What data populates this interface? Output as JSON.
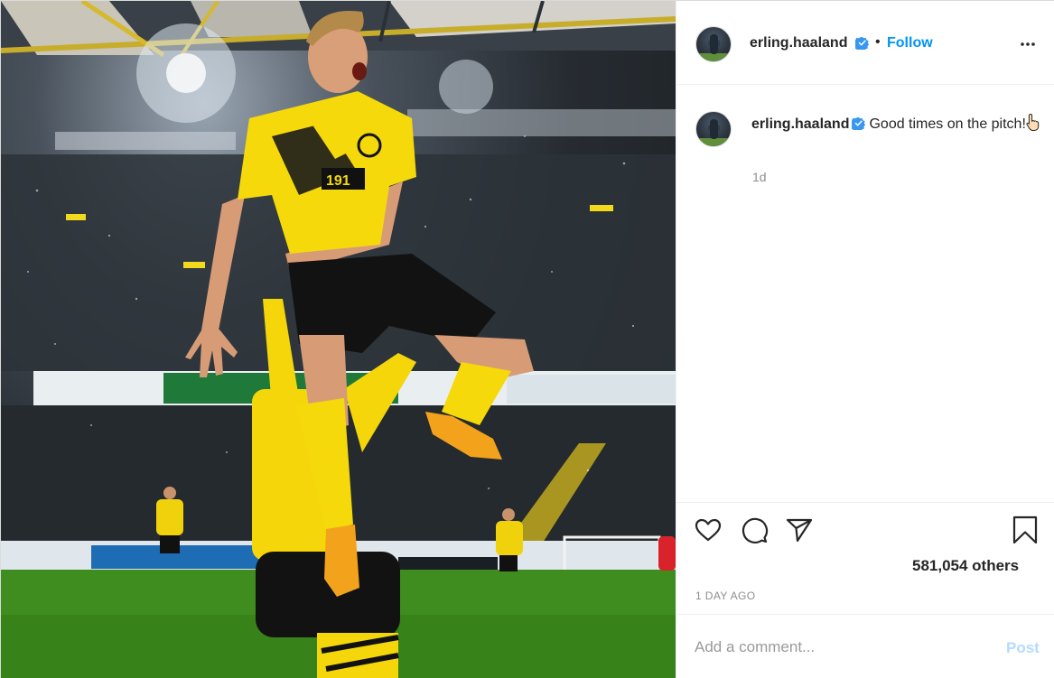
{
  "post": {
    "image_alt": "Footballer in yellow and black kit leaping in celebration in a stadium",
    "colors": {
      "kit_yellow": "#f5d90a",
      "kit_black": "#111111",
      "pitch_green": "#3f8d1e",
      "link_blue": "#0095f6",
      "post_disabled": "#b3dbff"
    }
  },
  "header": {
    "username": "erling.haaland",
    "separator": "•",
    "follow_label": "Follow",
    "verified_icon": "verified-badge-icon",
    "more_icon": "more-options-icon"
  },
  "caption": {
    "username": "erling.haaland",
    "text": "Good times on the pitch!",
    "emoji_icon": "pointing-hand-icon",
    "time": "1d"
  },
  "actions": {
    "like_icon": "heart-icon",
    "comment_icon": "comment-icon",
    "share_icon": "share-icon",
    "save_icon": "bookmark-icon",
    "likes_text": "581,054 others",
    "date_text": "1 DAY AGO"
  },
  "comment_box": {
    "placeholder": "Add a comment...",
    "post_label": "Post"
  }
}
